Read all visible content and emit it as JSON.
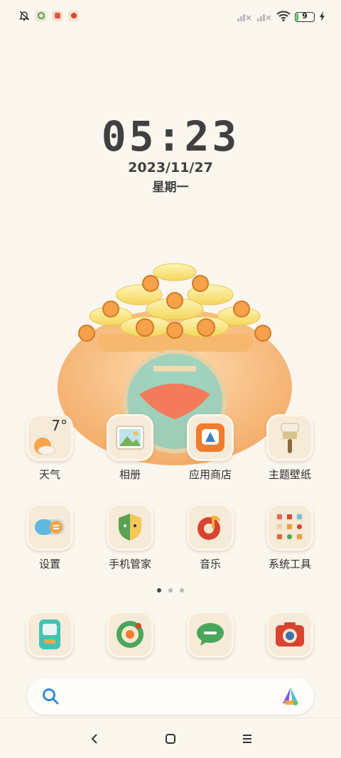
{
  "status_bar": {
    "left_icons": [
      "bell-off-icon",
      "app-notification-icon-1",
      "app-notification-icon-2",
      "app-notification-icon-3"
    ],
    "battery_level": "9",
    "charging": true
  },
  "lockscreen": {
    "time": "05:23",
    "date": "2023/11/27",
    "weekday": "星期一"
  },
  "apps_row1": [
    {
      "label": "天气",
      "icon": "weather-icon",
      "widget_temp": "7°"
    },
    {
      "label": "相册",
      "icon": "gallery-icon"
    },
    {
      "label": "应用商店",
      "icon": "app-store-icon"
    },
    {
      "label": "主题壁纸",
      "icon": "theme-brush-icon"
    }
  ],
  "apps_row2": [
    {
      "label": "设置",
      "icon": "settings-toggle-icon"
    },
    {
      "label": "手机管家",
      "icon": "security-shield-icon"
    },
    {
      "label": "音乐",
      "icon": "music-icon"
    },
    {
      "label": "系统工具",
      "icon": "system-tools-folder-icon"
    }
  ],
  "page_indicator": {
    "count": 3,
    "active": 0
  },
  "dock": [
    {
      "icon": "phone-icon"
    },
    {
      "icon": "browser-icon"
    },
    {
      "icon": "messages-icon"
    },
    {
      "icon": "camera-icon"
    }
  ],
  "search_bar": {
    "left_icon": "search-icon",
    "right_icon": "assistant-logo-icon"
  },
  "nav": [
    "back-icon",
    "home-icon",
    "menu-icon"
  ],
  "colors": {
    "background": "#fbf6ee",
    "tile": "#f6ead8",
    "accent_orange": "#f08a3a",
    "battery_green": "#47c25a"
  }
}
